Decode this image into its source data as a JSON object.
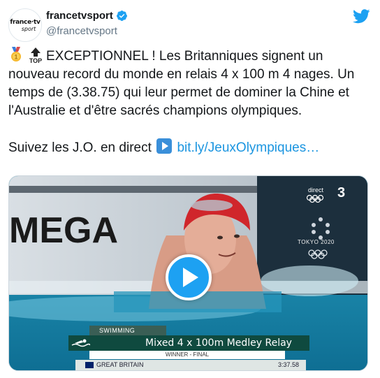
{
  "account": {
    "display_name": "francetvsport",
    "handle": "@francetvsport",
    "avatar_line1": "france·tv",
    "avatar_line2": "sport"
  },
  "tweet": {
    "emojis": [
      "1st-place-medal",
      "top-arrow",
      "play-button"
    ],
    "paragraph1": "EXCEPTIONNEL ! Les Britanniques signent un nouveau record du monde en relais 4 x 100 m 4 nages. Un temps de (3.38.75) qui leur permet de dominer la Chine et l'Australie et d'être sacrés champions olympiques.",
    "paragraph2_prefix": "Suivez les J.O. en direct",
    "link": "bit.ly/JeuxOlympiques…"
  },
  "video": {
    "channel_direct": "direct",
    "channel_number": "3",
    "tokyo_label": "TOKYO 2020",
    "banner_text": "MEGA",
    "lower_third": {
      "category": "SWIMMING",
      "event": "Mixed 4 x 100m Medley Relay",
      "stage": "WINNER - FINAL",
      "country": "GREAT BRITAIN",
      "time": "3:37.58"
    }
  },
  "colors": {
    "twitter_blue": "#1da1f2",
    "link_blue": "#1b95e0",
    "lower_third_green": "#0f4a3f"
  }
}
